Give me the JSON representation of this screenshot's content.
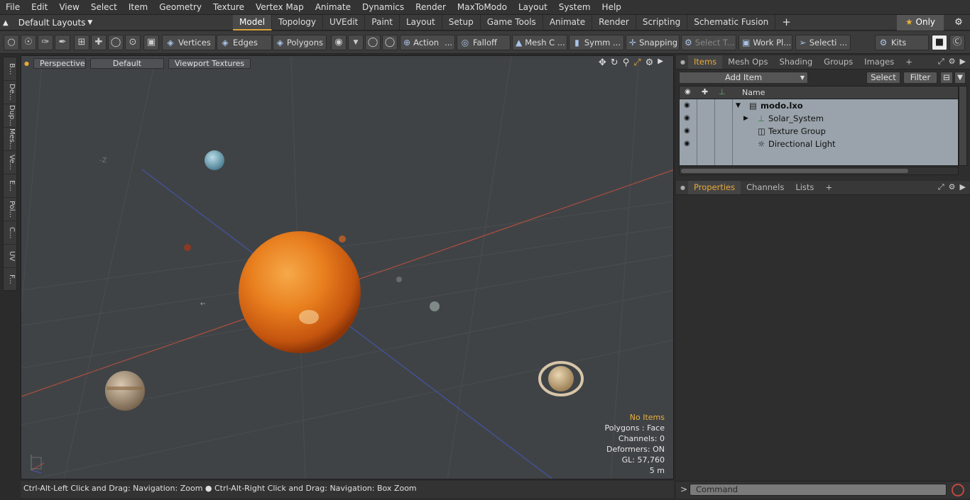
{
  "menu": [
    "File",
    "Edit",
    "View",
    "Select",
    "Item",
    "Geometry",
    "Texture",
    "Vertex Map",
    "Animate",
    "Dynamics",
    "Render",
    "MaxToModo",
    "Layout",
    "System",
    "Help"
  ],
  "layouts_label": "Default Layouts",
  "tabs": [
    "Model",
    "Topology",
    "UVEdit",
    "Paint",
    "Layout",
    "Setup",
    "Game Tools",
    "Animate",
    "Render",
    "Scripting",
    "Schematic Fusion"
  ],
  "only_label": "Only",
  "toolbar": {
    "vertices": "Vertices",
    "edges": "Edges",
    "polygons": "Polygons",
    "action": "Action",
    "action_more": "...",
    "falloff": "Falloff",
    "meshc": "Mesh C ...",
    "symm": "Symm ...",
    "snapping": "Snapping",
    "selectt": "Select T...",
    "workpl": "Work Pl...",
    "selecti": "Selecti ...",
    "kits": "Kits"
  },
  "left_tabs": [
    "B...",
    "De...",
    "Dup...",
    "Mes...",
    "Ve...",
    "E...",
    "Pol...",
    "C...",
    "UV",
    "F..."
  ],
  "viewport": {
    "perspective": "Perspective",
    "default": "Default",
    "textures": "Viewport Textures",
    "axis_label": "-Z",
    "info": {
      "no_items": "No Items",
      "polygons": "Polygons : Face",
      "channels": "Channels: 0",
      "deformers": "Deformers: ON",
      "gl": "GL: 57,760",
      "scale": "5 m"
    }
  },
  "status": "Ctrl-Alt-Left Click and Drag: Navigation: Zoom ● Ctrl-Alt-Right Click and Drag: Navigation: Box Zoom",
  "items_panel": {
    "tabs": [
      "Items",
      "Mesh Ops",
      "Shading",
      "Groups",
      "Images"
    ],
    "add_item": "Add Item",
    "select": "Select",
    "filter": "Filter",
    "name_col": "Name",
    "rows": [
      {
        "label": "modo.lxo"
      },
      {
        "label": "Solar_System"
      },
      {
        "label": "Texture Group"
      },
      {
        "label": "Directional Light"
      }
    ]
  },
  "props_panel": {
    "tabs": [
      "Properties",
      "Channels",
      "Lists"
    ]
  },
  "command": {
    "placeholder": "Command",
    "prompt": ">"
  },
  "colors": {
    "accent": "#e7a73a",
    "viewport_bg": "#404346",
    "sun": "#e07a1f",
    "x_axis": "#c0503e",
    "z_axis": "#4656b8"
  }
}
